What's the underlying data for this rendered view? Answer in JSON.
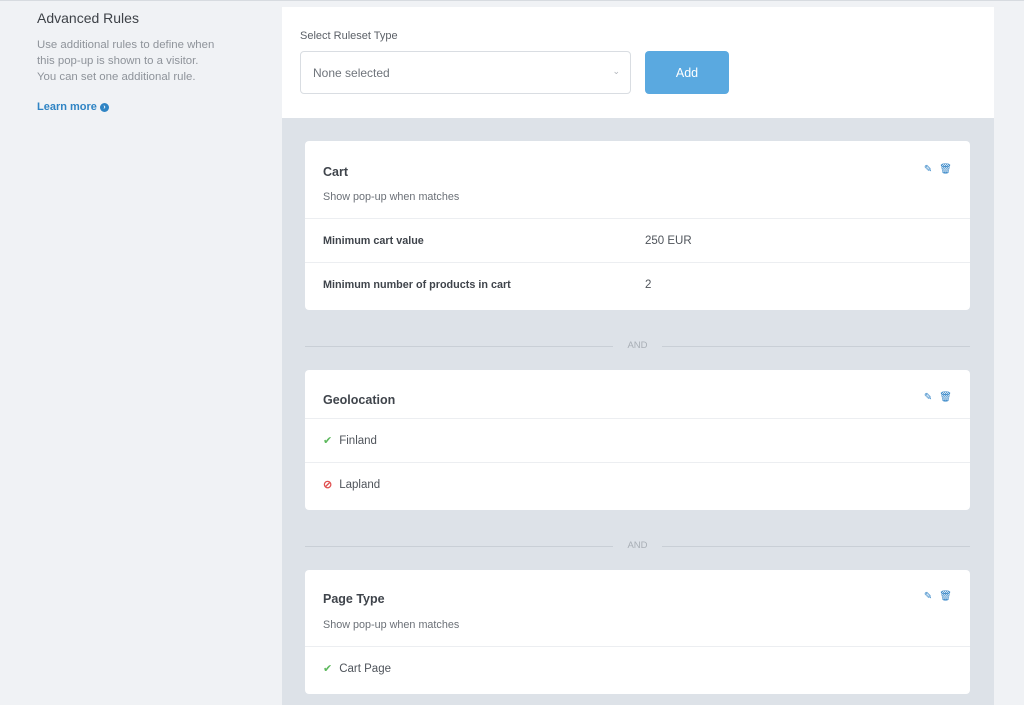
{
  "side": {
    "title": "Advanced Rules",
    "desc_line1": "Use additional rules to define when",
    "desc_line2": "this pop-up is shown to a visitor.",
    "desc_line3": "You can set one additional rule.",
    "learn_more": "Learn more",
    "learn_icon": "arrow-circle-right-icon"
  },
  "ruleset": {
    "label": "Select Ruleset Type",
    "selected": "None selected",
    "add_label": "Add"
  },
  "connector_label": "AND",
  "cart": {
    "title": "Cart",
    "subtitle": "Show pop-up when matches",
    "rows": [
      {
        "key": "Minimum cart value",
        "value": "250 EUR"
      },
      {
        "key": "Minimum number of products in cart",
        "value": "2"
      }
    ]
  },
  "geolocation": {
    "title": "Geolocation",
    "items": [
      {
        "label": "Finland",
        "status": "include",
        "icon": "check-icon"
      },
      {
        "label": "Lapland",
        "status": "exclude",
        "icon": "ban-icon"
      }
    ]
  },
  "page_type": {
    "title": "Page Type",
    "subtitle": "Show pop-up when matches",
    "items": [
      {
        "label": "Cart Page",
        "status": "include",
        "icon": "check-icon"
      }
    ]
  },
  "colors": {
    "accent": "#2a7fc4",
    "button": "#5aa9e0",
    "include": "#5cb85c",
    "exclude": "#e05252",
    "panel_bg": "#dde2e8"
  }
}
